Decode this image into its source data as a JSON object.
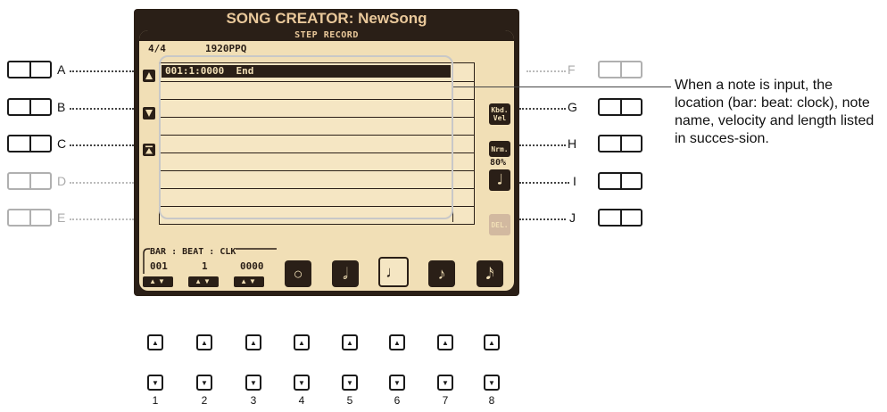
{
  "screen_title": "SONG CREATOR: NewSong",
  "panel_header": "STEP RECORD",
  "info": {
    "time_sig": "4/4",
    "ppq": "1920PPQ"
  },
  "event_list": {
    "first_row": "001:1:0000  End"
  },
  "position": {
    "bar_label": "BAR",
    "beat_label": "BEAT",
    "clk_label": "CLK",
    "sep": ":",
    "bar": "001",
    "beat": "1",
    "clk": "0000",
    "updown": "▲▼"
  },
  "left_buttons": [
    {
      "label": "A",
      "active": true
    },
    {
      "label": "B",
      "active": true
    },
    {
      "label": "C",
      "active": true
    },
    {
      "label": "D",
      "active": false
    },
    {
      "label": "E",
      "active": false
    }
  ],
  "right_buttons": [
    {
      "label": "F",
      "active": false
    },
    {
      "label": "G",
      "active": true
    },
    {
      "label": "H",
      "active": true
    },
    {
      "label": "I",
      "active": true
    },
    {
      "label": "J",
      "active": true
    }
  ],
  "right_icons": {
    "kbd_vel": [
      "Kbd.",
      "Vel"
    ],
    "nrm": "Nrm.",
    "gate": "80%",
    "quarter_note": "♩",
    "delete": "DEL."
  },
  "note_buttons": [
    "○",
    "𝅗𝅥",
    "♩",
    "♪",
    "𝅘𝅥𝅯"
  ],
  "bottom_button_numbers": [
    "1",
    "2",
    "3",
    "4",
    "5",
    "6",
    "7",
    "8"
  ],
  "bottom_arrows": {
    "up": "▲",
    "down": "▼"
  },
  "callout": "When a note is input, the location (bar: beat: clock), note name, velocity and length listed in succes-sion.",
  "colors": {
    "lcd_dark": "#2a1f17",
    "lcd_bg": "#f1dfb6",
    "title_text": "#e9c89a"
  }
}
